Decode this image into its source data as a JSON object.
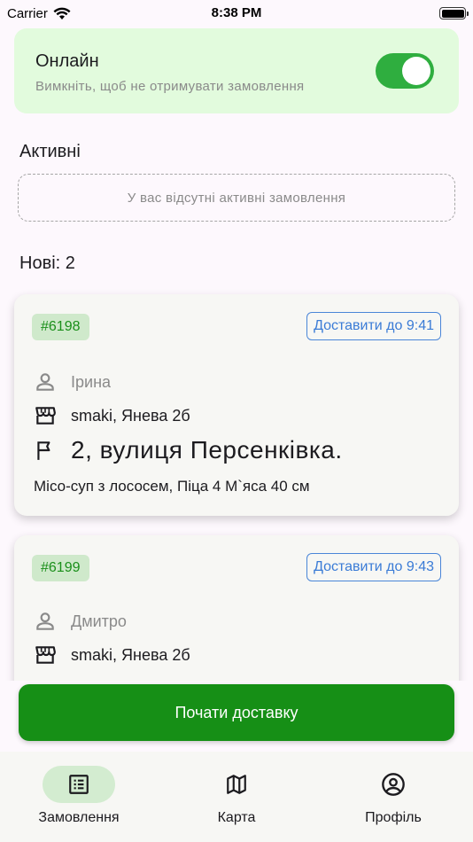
{
  "status_bar": {
    "carrier": "Carrier",
    "time": "8:38 PM"
  },
  "online": {
    "title": "Онлайн",
    "subtitle": "Вимкніть, щоб не отримувати замовлення",
    "toggle_on": true,
    "accent": "#2fae3f"
  },
  "active": {
    "title": "Активні",
    "empty_text": "У вас відсутні активні замовлення"
  },
  "new_orders": {
    "title": "Нові: 2",
    "orders": [
      {
        "id": "#6198",
        "deliver_by": "Доставити до 9:41",
        "customer": "Ірина",
        "restaurant": "smaki, Янева 2б",
        "address": "2, вулиця Персенківка.",
        "items": "Місо-суп з лососем, Піца 4 М`яса 40 см"
      },
      {
        "id": "#6199",
        "deliver_by": "Доставити до 9:43",
        "customer": "Дмитро",
        "restaurant": "smaki, Янева 2б"
      }
    ]
  },
  "start_button": {
    "label": "Почати доставку",
    "color": "#168f16"
  },
  "bottom_nav": {
    "items": [
      {
        "label": "Замовлення",
        "icon": "list-icon",
        "active": true
      },
      {
        "label": "Карта",
        "icon": "map-icon",
        "active": false
      },
      {
        "label": "Профіль",
        "icon": "account-circle-icon",
        "active": false
      }
    ]
  }
}
